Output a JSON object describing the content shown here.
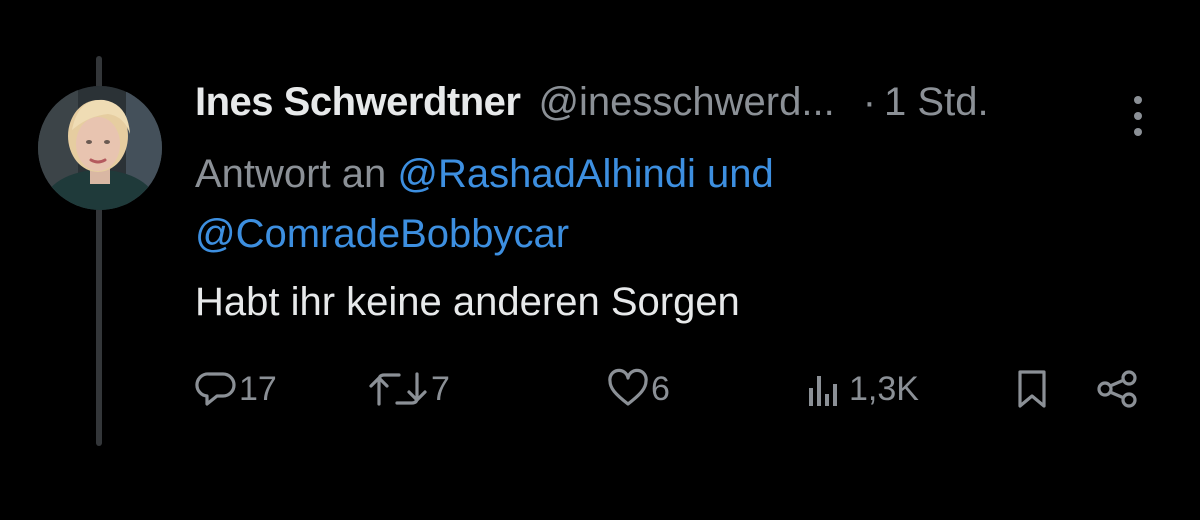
{
  "tweet": {
    "author": {
      "display_name": "Ines Schwerdtner",
      "handle": "@inesschwerd...",
      "avatar_icon": "profile-photo"
    },
    "separator": "·",
    "time": "1 Std.",
    "reply_prefix": "Antwort an",
    "reply_mention_1": "@RashadAlhindi",
    "reply_and": "und",
    "reply_mention_2": "@ComradeBobbycar",
    "text": "Habt ihr keine anderen Sorgen"
  },
  "actions": {
    "replies": "17",
    "reposts": "7",
    "likes": "6",
    "views": "1,3K"
  },
  "icons": {
    "more": "more-vertical-icon",
    "reply": "reply-icon",
    "repost": "repost-icon",
    "like": "heart-icon",
    "views": "views-icon",
    "bookmark": "bookmark-icon",
    "share": "share-icon"
  },
  "colors": {
    "background": "#000000",
    "text_primary": "#e7e9ea",
    "text_secondary": "#8b9096",
    "link": "#3d8fe0",
    "thread_line": "#333639"
  }
}
